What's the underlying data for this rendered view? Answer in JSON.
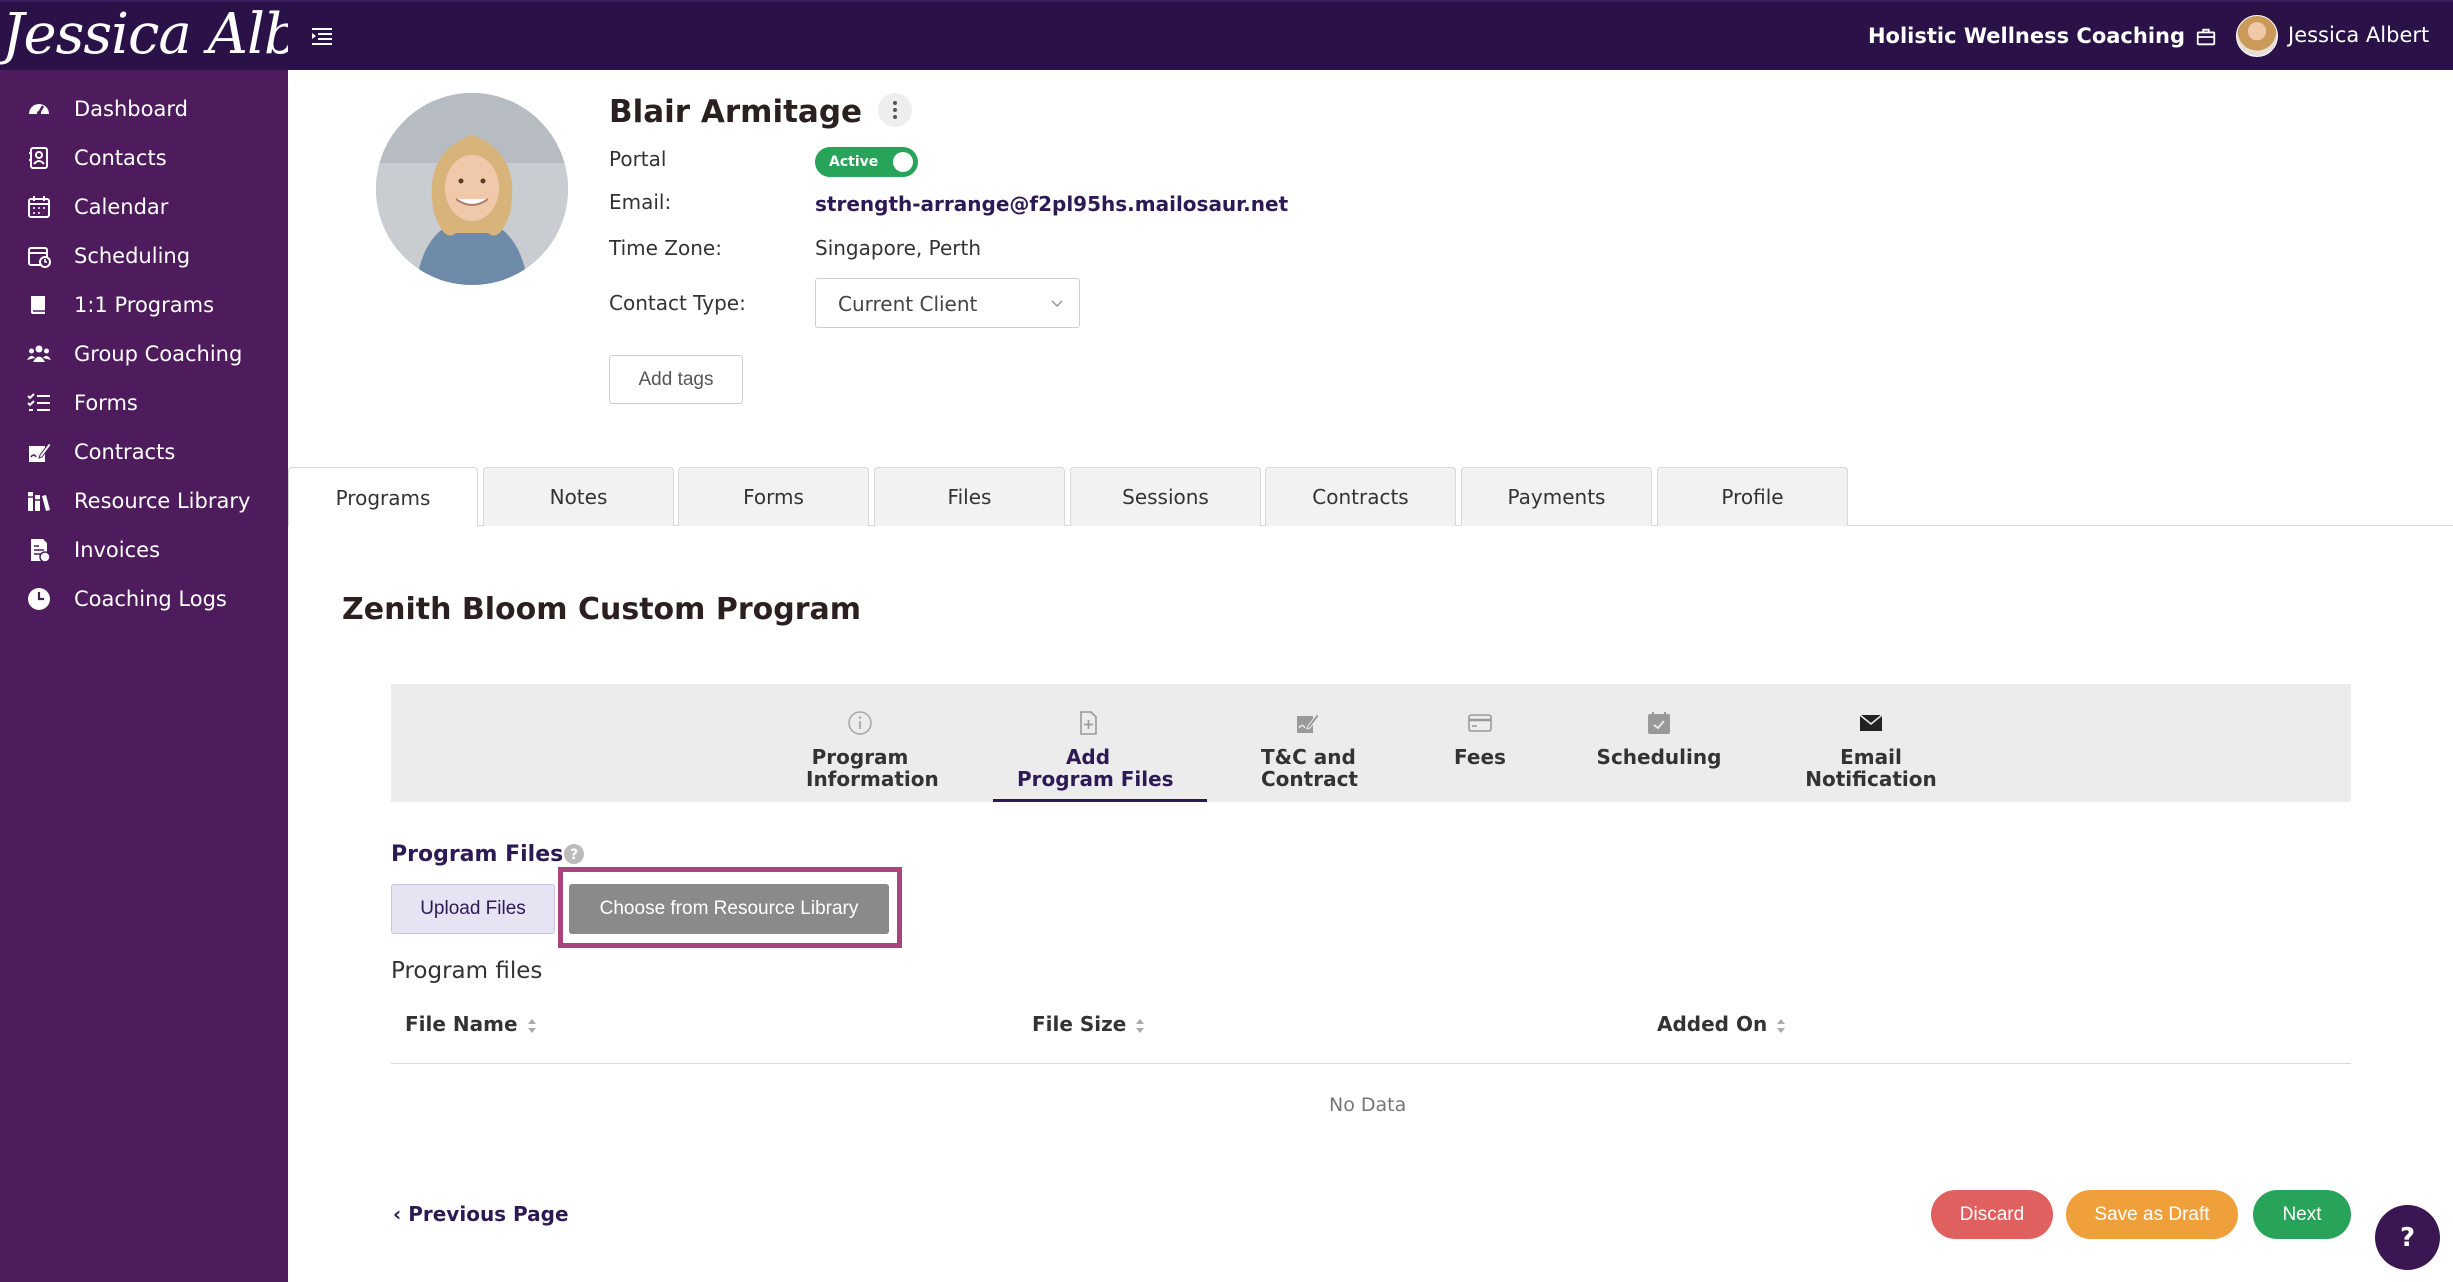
{
  "header": {
    "logo_text": "Jessica Albert",
    "business_name": "Holistic Wellness Coaching",
    "user_name": "Jessica Albert"
  },
  "sidebar": {
    "items": [
      {
        "label": "Dashboard",
        "icon": "dashboard-icon"
      },
      {
        "label": "Contacts",
        "icon": "contacts-icon"
      },
      {
        "label": "Calendar",
        "icon": "calendar-icon"
      },
      {
        "label": "Scheduling",
        "icon": "scheduling-icon"
      },
      {
        "label": "1:1 Programs",
        "icon": "book-icon"
      },
      {
        "label": "Group Coaching",
        "icon": "group-icon"
      },
      {
        "label": "Forms",
        "icon": "checklist-icon"
      },
      {
        "label": "Contracts",
        "icon": "signature-icon"
      },
      {
        "label": "Resource Library",
        "icon": "library-icon"
      },
      {
        "label": "Invoices",
        "icon": "invoice-icon"
      },
      {
        "label": "Coaching Logs",
        "icon": "clock-icon"
      }
    ]
  },
  "contact": {
    "name": "Blair Armitage",
    "portal_label": "Portal",
    "portal_status": "Active",
    "email_label": "Email:",
    "email": "strength-arrange@f2pl95hs.mailosaur.net",
    "timezone_label": "Time Zone:",
    "timezone": "Singapore, Perth",
    "contact_type_label": "Contact Type:",
    "contact_type": "Current Client",
    "add_tags_label": "Add tags"
  },
  "tabs": [
    "Programs",
    "Notes",
    "Forms",
    "Files",
    "Sessions",
    "Contracts",
    "Payments",
    "Profile"
  ],
  "active_tab": "Programs",
  "program": {
    "title": "Zenith Bloom Custom Program",
    "steps": [
      {
        "line1": "Program",
        "line2": "Information",
        "icon": "info-icon"
      },
      {
        "line1": "Add",
        "line2": "Program Files",
        "icon": "file-add-icon"
      },
      {
        "line1": "T&C and",
        "line2": "Contract",
        "icon": "signature-doc-icon"
      },
      {
        "line1": "Fees",
        "line2": "",
        "icon": "credit-card-icon"
      },
      {
        "line1": "Scheduling",
        "line2": "",
        "icon": "calendar-check-icon"
      },
      {
        "line1": "Email",
        "line2": "Notification",
        "icon": "envelope-icon"
      }
    ],
    "active_step": "Add Program Files"
  },
  "files_section": {
    "title": "Program Files",
    "upload_label": "Upload Files",
    "choose_label": "Choose from Resource Library",
    "list_heading": "Program files",
    "columns": [
      "File Name",
      "File Size",
      "Added On"
    ],
    "empty_text": "No Data"
  },
  "footer": {
    "previous_label": "Previous Page",
    "discard_label": "Discard",
    "draft_label": "Save as Draft",
    "next_label": "Next",
    "help_label": "?"
  },
  "colors": {
    "topbar": "#2a1147",
    "sidebar": "#4e1c5c",
    "accent": "#2d1a55",
    "active_toggle": "#27a35a",
    "discard": "#e05f5f",
    "draft": "#f0a03a",
    "next": "#27a35a",
    "highlight": "#a8447e"
  }
}
